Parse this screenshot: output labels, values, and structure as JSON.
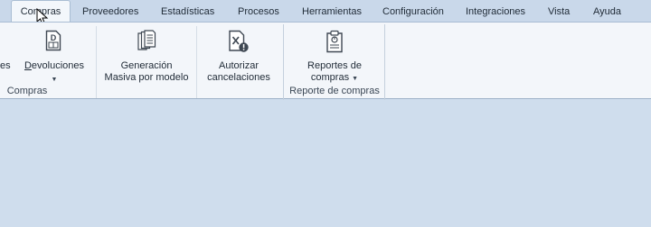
{
  "menu": {
    "tabs": [
      {
        "label": "Compras",
        "active": true
      },
      {
        "label": "Proveedores"
      },
      {
        "label": "Estadísticas"
      },
      {
        "label": "Procesos"
      },
      {
        "label": "Herramientas"
      },
      {
        "label": "Configuración"
      },
      {
        "label": "Integraciones"
      },
      {
        "label": "Vista"
      },
      {
        "label": "Ayuda"
      }
    ]
  },
  "ribbon": {
    "compras_group": {
      "label": "Compras",
      "partial_button_label": "es",
      "devoluciones": {
        "label": "Devoluciones",
        "underline_char": "D",
        "icon": "document-d-icon"
      },
      "generacion": {
        "line1": "Generación",
        "line2": "Masiva por modelo",
        "icon": "documents-stack-icon"
      },
      "autorizar": {
        "line1": "Autorizar",
        "line2": "cancelaciones",
        "icon": "document-cancel-icon"
      }
    },
    "reporte_group": {
      "label": "Reporte de compras",
      "reportes": {
        "line1": "Reportes de",
        "line2": "compras",
        "icon": "clipboard-report-icon"
      }
    }
  },
  "colors": {
    "background": "#cfdded",
    "tabbar": "#c9d8ea",
    "ribbon": "#f3f6fa",
    "active_tab": "#f3f7fb"
  }
}
